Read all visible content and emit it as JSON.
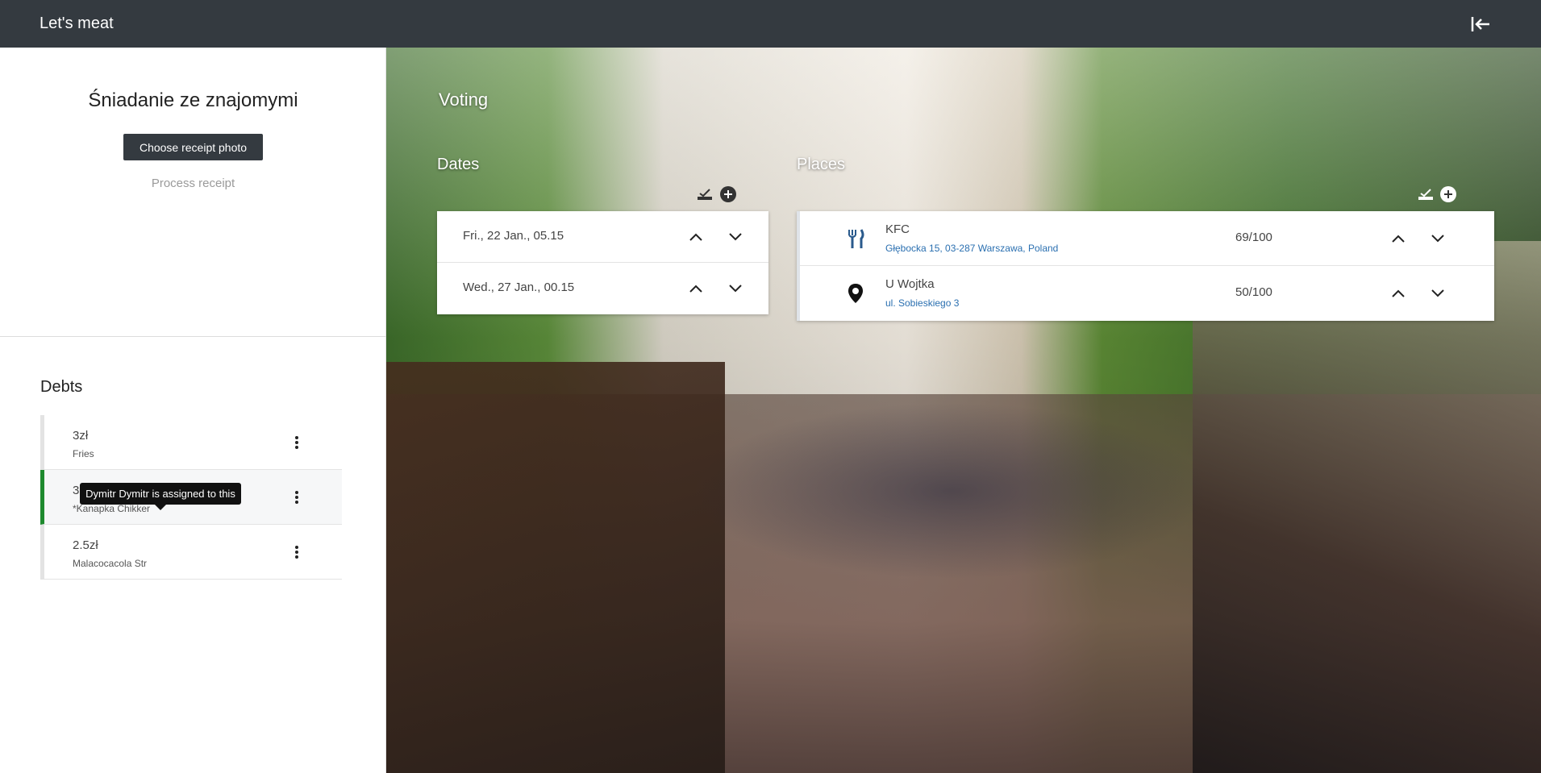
{
  "header": {
    "brand": "Let's meat"
  },
  "sidebar": {
    "event_title": "Śniadanie ze znajomymi",
    "choose_receipt_label": "Choose receipt photo",
    "process_receipt_label": "Process receipt",
    "debts_title": "Debts",
    "debts": [
      {
        "amount": "3zł",
        "name": "Fries"
      },
      {
        "amount": "3.5zł",
        "name": "*Kanapka Chikker"
      },
      {
        "amount": "2.5zł",
        "name": "Malacocacola Str"
      }
    ],
    "tooltip": "Dymitr  Dymitr  is assigned to this"
  },
  "main": {
    "voting_title": "Voting",
    "dates_title": "Dates",
    "places_title": "Places",
    "dates": [
      {
        "label": "Fri., 22 Jan., 05.15"
      },
      {
        "label": "Wed., 27 Jan., 00.15"
      }
    ],
    "places": [
      {
        "name": "KFC",
        "address": "Głębocka 15, 03-287 Warszawa, Poland",
        "score": "69/100",
        "icon": "fork-knife-icon"
      },
      {
        "name": "U Wojtka",
        "address": "ul. Sobieskiego 3",
        "score": "50/100",
        "icon": "map-pin-icon"
      }
    ]
  },
  "colors": {
    "topbar": "#343a40",
    "active_debt_border": "#1e8a2e",
    "address_link": "#2a6fb0"
  }
}
